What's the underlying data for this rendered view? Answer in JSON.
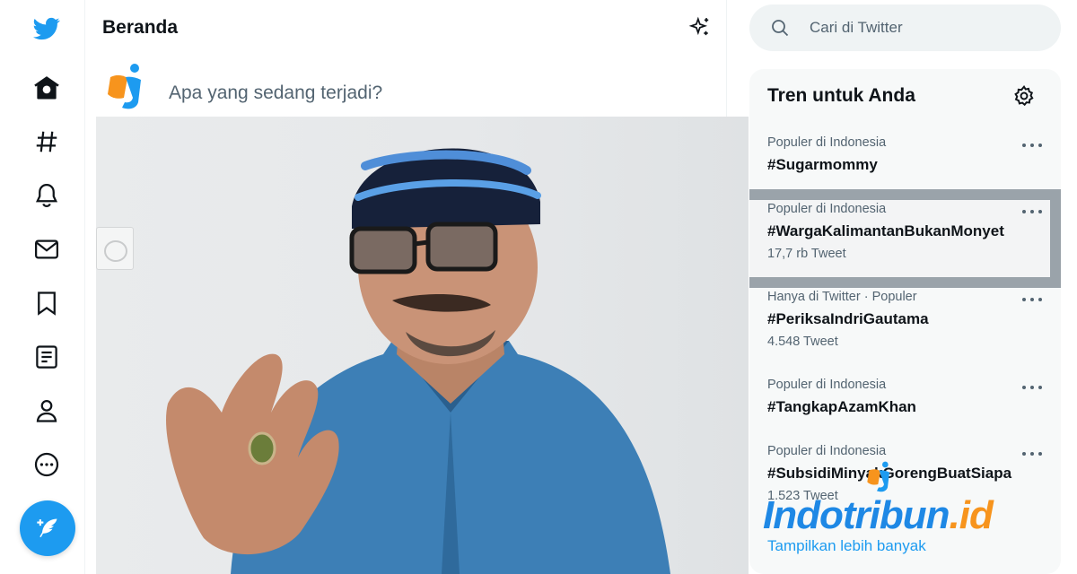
{
  "main": {
    "title": "Beranda",
    "composer_placeholder": "Apa yang sedang terjadi?"
  },
  "search": {
    "placeholder": "Cari di Twitter"
  },
  "trends": {
    "title": "Tren untuk Anda",
    "items": [
      {
        "meta": "Populer di Indonesia",
        "tag": "#Sugarmommy",
        "count": ""
      },
      {
        "meta": "Populer di Indonesia",
        "tag": "#WargaKalimantanBukanMonyet",
        "count": "17,7 rb Tweet"
      },
      {
        "meta": "Hanya di Twitter · Populer",
        "tag": "#PeriksaIndriGautama",
        "count": "4.548 Tweet"
      },
      {
        "meta": "Populer di Indonesia",
        "tag": "#TangkapAzamKhan",
        "count": ""
      },
      {
        "meta": "Populer di Indonesia",
        "tag": "#SubsidiMinyakGorengBuatSiapa",
        "count": "1.523 Tweet"
      }
    ],
    "show_more": "Tampilkan lebih banyak"
  },
  "watermark": {
    "text_main": "Indotribun",
    "text_suffix": ".id"
  },
  "colors": {
    "accent": "#1d9bf0",
    "watermark_blue": "#1e88e5",
    "watermark_orange": "#f7941d"
  },
  "icons": {
    "nav": [
      "twitter-bird-icon",
      "home-icon",
      "hashtag-icon",
      "bell-icon",
      "mail-icon",
      "bookmark-icon",
      "list-icon",
      "profile-icon",
      "more-circle-icon"
    ],
    "compose": "feather-plus-icon",
    "top_tweets": "sparkle-icon",
    "search": "search-icon",
    "settings": "gear-icon"
  }
}
